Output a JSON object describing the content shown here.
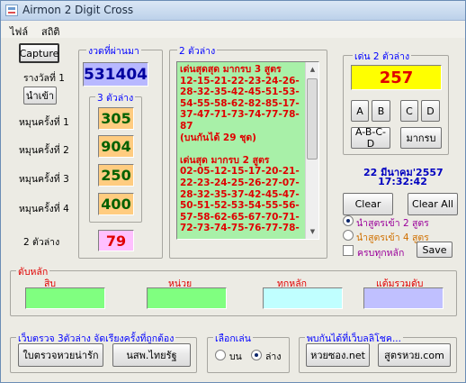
{
  "window": {
    "title": "Airmon 2 Digit Cross"
  },
  "menu": {
    "file": "ไฟล์",
    "stats": "สถิติ"
  },
  "left": {
    "capture_label": "Capture",
    "round_label": "รางวัลที่ 1",
    "fetch_label": "นำเข้า",
    "draw_labels": [
      "หมุนครั้งที่ 1",
      "หมุนครั้งที่ 2",
      "หมุนครั้งที่ 3",
      "หมุนครั้งที่ 4"
    ],
    "two_bottom_label": "2 ตัวล่าง"
  },
  "past_draw": {
    "group_label": "งวดที่ผ่านมา",
    "value": "531404",
    "three_bottom_label": "3 ตัวล่าง",
    "spins": [
      "305",
      "904",
      "250",
      "400"
    ],
    "two_bottom": "79"
  },
  "two_bottom_panel": {
    "group_label": "2 ตัวล่าง",
    "text": "เด่นสุดสุด มากรบ 3 สูตร\n12-15-21-22-23-24-26-\n28-32-35-42-45-51-53-\n54-55-58-62-82-85-17-\n37-47-71-73-74-77-78-\n87\n(บนกันได้ 29 ชุด)\n\nเด่นสุด มากรบ 2 สูตร\n02-05-12-15-17-20-21-\n22-23-24-25-26-27-07-\n28-32-35-37-42-45-47-\n50-51-52-53-54-55-56-\n57-58-62-65-67-70-71-\n72-73-74-75-76-77-78-"
  },
  "highlight": {
    "group_label": "เด่น 2 ตัวล่าง",
    "value": "257",
    "btn_a": "A",
    "btn_b": "B",
    "btn_c": "C",
    "btn_d": "D",
    "btn_abcd": "A-B-C-D",
    "btn_full": "มากรบ"
  },
  "datetime": {
    "date": "22 มีนาคม'2557",
    "time": "17:32:42"
  },
  "actions": {
    "clear": "Clear",
    "clear_all": "Clear All",
    "opt_2": "นำสูตรเข้า 2 สูตร",
    "opt_4": "นำสูตรเข้า 4 สูตร",
    "check_all": "ครบทุกหลัก",
    "save": "Save"
  },
  "rank": {
    "group_label": "ดับหลัก",
    "tens": "สิบ",
    "units": "หน่วย",
    "all_digits": "ทุกหลัก",
    "combined": "แต้มรวมดับ"
  },
  "colors": {
    "tens": "#80ff80",
    "units": "#80ff80",
    "all_digits": "#c0ffff",
    "combined": "#c0c0ff"
  },
  "links_left": {
    "group_label": "เว็บตรวจ 3ตัวล่าง จัดเรียงครั้งที่ถูกต้อง",
    "btn1": "ใบตรวจหวยน่ารัก",
    "btn2": "นสพ.ไทยรัฐ"
  },
  "choose": {
    "group_label": "เลือกเล่น",
    "top": "บน",
    "bottom": "ล่าง"
  },
  "links_right": {
    "group_label": "พบกันได้ที่เว็บลลิโชค...",
    "btn1": "หวยซอง.net",
    "btn2": "สูตรหวย.com"
  },
  "icons": [
    "app-icon",
    "scroll-up-icon",
    "scroll-down-icon"
  ]
}
